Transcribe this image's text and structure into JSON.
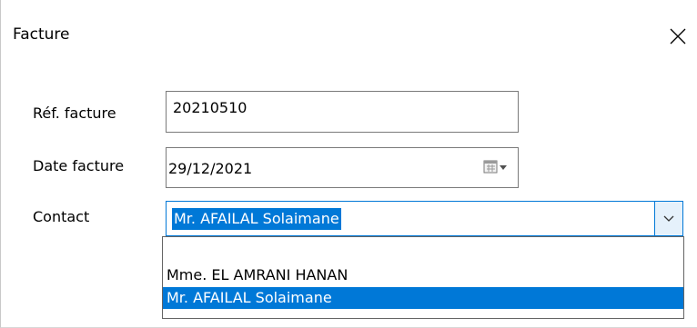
{
  "window": {
    "title": "Facture",
    "close_icon": "close-icon"
  },
  "form": {
    "ref_label": "Réf. facture",
    "ref_value": "20210510",
    "date_label": "Date facture",
    "date_value": "29/12/2021",
    "date_icon": "calendar-dropdown-icon",
    "contact_label": "Contact",
    "contact_value": "Mr. AFAILAL Solaimane",
    "contact_arrow_icon": "chevron-down-icon"
  },
  "dropdown": {
    "options": [
      "",
      "Mme. EL AMRANI HANAN",
      "Mr. AFAILAL Solaimane"
    ],
    "selected_index": 2
  },
  "colors": {
    "accent": "#0078d7",
    "selection_text": "#ffffff"
  }
}
